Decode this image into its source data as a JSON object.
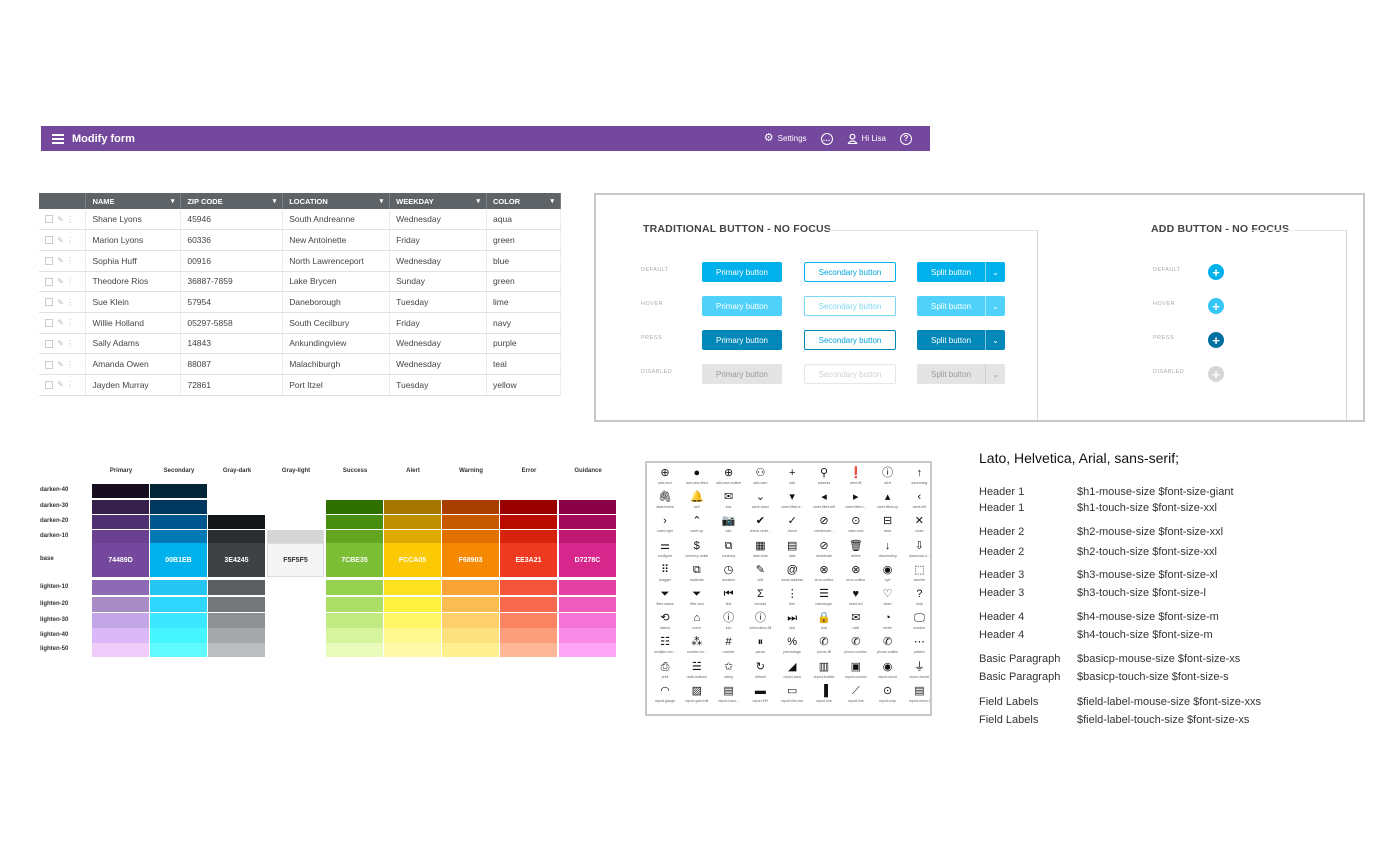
{
  "appbar": {
    "title": "Modify form",
    "settings_label": "Settings",
    "user_label": "Hi Lisa",
    "color": "#74489D"
  },
  "table": {
    "columns": [
      "NAME",
      "ZIP CODE",
      "LOCATION",
      "WEEKDAY",
      "COLOR"
    ],
    "rows": [
      [
        "Shane Lyons",
        "45946",
        "South Andreanne",
        "Wednesday",
        "aqua"
      ],
      [
        "Marion Lyons",
        "60336",
        "New Antoinette",
        "Friday",
        "green"
      ],
      [
        "Sophia Huff",
        "00916",
        "North Lawrenceport",
        "Wednesday",
        "blue"
      ],
      [
        "Theodore Rios",
        "36887-7859",
        "Lake Brycen",
        "Sunday",
        "green"
      ],
      [
        "Sue Klein",
        "57954",
        "Daneborough",
        "Tuesday",
        "lime"
      ],
      [
        "Willie Holland",
        "05297-5858",
        "South Cecilbury",
        "Friday",
        "navy"
      ],
      [
        "Sally Adams",
        "14843",
        "Ankundingview",
        "Wednesday",
        "purple"
      ],
      [
        "Amanda Owen",
        "88087",
        "Malachiburgh",
        "Wednesday",
        "teal"
      ],
      [
        "Jayden Murray",
        "72861",
        "Port Itzel",
        "Tuesday",
        "yellow"
      ]
    ]
  },
  "buttons_panel": {
    "traditional_title": "TRADITIONAL BUTTON - NO FOCUS",
    "add_title": "ADD BUTTON - NO FOCUS",
    "states": [
      "DEFAULT",
      "HOVER",
      "PRESS",
      "DISABLED"
    ],
    "primary_label": "Primary button",
    "secondary_label": "Secondary button",
    "split_label": "Split button"
  },
  "palette": {
    "columns": [
      "Primary",
      "Secondary",
      "Gray-dark",
      "Gray-light",
      "Success",
      "Alert",
      "Warning",
      "Error",
      "Guidance"
    ],
    "rows": [
      "darken-40",
      "darken-30",
      "darken-20",
      "darken-10",
      "base",
      "lighten-10",
      "lighten-20",
      "lighten-30",
      "lighten-40",
      "lighten-50"
    ],
    "base_labels": [
      "74489D",
      "00B1EB",
      "3E4245",
      "F5F5F5",
      "7CBE35",
      "FCCA05",
      "F68903",
      "EE3A21",
      "D7278C"
    ],
    "colors": [
      [
        "#160d1f",
        "#361f4b",
        "#4f3172",
        "#6b4091",
        "#74489D",
        "#8e6ab4",
        "#a98bc6",
        "#c3a6e6",
        "#dbb8f7",
        "#f0ccfb"
      ],
      [
        "#002536",
        "#003760",
        "#00578f",
        "#0079b5",
        "#00B1EB",
        "#25c7f2",
        "#2fd6ff",
        "#3be8ff",
        "#45f5ff",
        "#5ffbff"
      ],
      [
        "",
        "",
        "#131618",
        "#2a2d30",
        "#3E4245",
        "#5b5f62",
        "#74787b",
        "#8d9194",
        "#a4a8ab",
        "#bbbfc1"
      ],
      [
        "",
        "",
        "",
        "#d6d6d6",
        "#F5F5F5",
        "",
        "",
        "",
        "",
        ""
      ],
      [
        "",
        "#2f6f00",
        "#478d0e",
        "#62a521",
        "#7CBE35",
        "#96d24f",
        "#acdf66",
        "#c2ea82",
        "#d6f39d",
        "#e9fbba"
      ],
      [
        "",
        "#a57700",
        "#c08f00",
        "#dcaa00",
        "#FCCA05",
        "#fde21f",
        "#fff23e",
        "#fff668",
        "#fff88e",
        "#fff9a8"
      ],
      [
        "",
        "#a83e00",
        "#c65800",
        "#e07100",
        "#F68903",
        "#f9a336",
        "#fbbd52",
        "#fdd06b",
        "#fee17f",
        "#fff08f"
      ],
      [
        "",
        "#9a0000",
        "#b90b00",
        "#d6230e",
        "#EE3A21",
        "#f4553a",
        "#f86a4e",
        "#fb8463",
        "#fd9e7c",
        "#ffb79a"
      ],
      [
        "",
        "#8a0047",
        "#a40a5c",
        "#bf1873",
        "#D7278C",
        "#e441a4",
        "#ed5bbd",
        "#f473d4",
        "#f98ae6",
        "#fda6f5"
      ]
    ]
  },
  "icons": {
    "items": [
      [
        "⊕",
        "add-mini"
      ],
      [
        "●",
        "add-new-filled"
      ],
      [
        "⊕",
        "add-new-outline"
      ],
      [
        "⚇",
        "add-user"
      ],
      [
        "+",
        "add"
      ],
      [
        "⚲",
        "address"
      ],
      [
        "❗",
        "alert-fill"
      ],
      [
        "ⓘ",
        "alert"
      ],
      [
        "↑",
        "ascending"
      ],
      [
        "🖇",
        "attachment"
      ],
      [
        "🔔",
        "bell"
      ],
      [
        "✉",
        "box"
      ],
      [
        "⌄",
        "caret-down"
      ],
      [
        "▾",
        "caret-filled-d..."
      ],
      [
        "◂",
        "caret-filled-left"
      ],
      [
        "▸",
        "caret-filled-r..."
      ],
      [
        "▴",
        "caret-filled-up"
      ],
      [
        "‹",
        "caret-left"
      ],
      [
        "›",
        "caret-right"
      ],
      [
        "⌃",
        "caret-up"
      ],
      [
        "📷",
        "cart"
      ],
      [
        "✔",
        "check-circle..."
      ],
      [
        "✓",
        "check"
      ],
      [
        "⊘",
        "checkmark..."
      ],
      [
        "⊙",
        "clear-mini"
      ],
      [
        "⊟",
        "clear"
      ],
      [
        "✕",
        "close"
      ],
      [
        "⚌",
        "configure"
      ],
      [
        "$",
        "currency-dollar"
      ],
      [
        "⧉",
        "currency"
      ],
      [
        "▦",
        "date-time"
      ],
      [
        "▤",
        "date"
      ],
      [
        "⊘",
        "deactivate"
      ],
      [
        "🗑",
        "delete"
      ],
      [
        "↓",
        "descending"
      ],
      [
        "⇩",
        "download-o..."
      ],
      [
        "⠿",
        "dragger"
      ],
      [
        "⧉",
        "duplicate"
      ],
      [
        "◷",
        "duration"
      ],
      [
        "✎",
        "edit"
      ],
      [
        "@",
        "email-address"
      ],
      [
        "⊗",
        "error-outline"
      ],
      [
        "⊗",
        "error-outline"
      ],
      [
        "◉",
        "eye"
      ],
      [
        "⬚",
        "favorite"
      ],
      [
        "⏷",
        "filter-status"
      ],
      [
        "⏷",
        "filter-tool"
      ],
      [
        "⏮",
        "first"
      ],
      [
        "Σ",
        "formula"
      ],
      [
        "⋮",
        "free"
      ],
      [
        "☰",
        "hamburger"
      ],
      [
        "♥",
        "heart-full"
      ],
      [
        "♡",
        "heart"
      ],
      [
        "?",
        "help"
      ],
      [
        "⟲",
        "history"
      ],
      [
        "⌂",
        "home"
      ],
      [
        "ⓘ",
        "info"
      ],
      [
        "ⓘ",
        "information-fill"
      ],
      [
        "⏭",
        "last"
      ],
      [
        "🔒",
        "lock"
      ],
      [
        "✉",
        "mail"
      ],
      [
        "◔",
        "meter"
      ],
      [
        "🖵",
        "monitor"
      ],
      [
        "☷",
        "multiple-che..."
      ],
      [
        "⁂",
        "number-for..."
      ],
      [
        "#",
        "number"
      ],
      [
        "⏸",
        "pause"
      ],
      [
        "%",
        "percentage"
      ],
      [
        "✆",
        "phone-fill"
      ],
      [
        "✆",
        "phone-number"
      ],
      [
        "✆",
        "phone-outline"
      ],
      [
        "⋯",
        "pickles"
      ],
      [
        "⎙",
        "print"
      ],
      [
        "☱",
        "radio-buttons"
      ],
      [
        "✩",
        "rating"
      ],
      [
        "↻",
        "refresh"
      ],
      [
        "◢",
        "report-area"
      ],
      [
        "▥",
        "report-bubble"
      ],
      [
        "▣",
        "report-column"
      ],
      [
        "◉",
        "report-donut"
      ],
      [
        "⏚",
        "report-funnel"
      ],
      [
        "◠",
        "report-gauge"
      ],
      [
        "▨",
        "report-grid-edit"
      ],
      [
        "▤",
        "report-horiz..."
      ],
      [
        "▬",
        "report-KPI"
      ],
      [
        "▭",
        "report-line-bar"
      ],
      [
        "▐",
        "report-line"
      ],
      [
        "⟋",
        "report-line"
      ],
      [
        "⊙",
        "report-map"
      ],
      [
        "▤",
        "report-menu-f"
      ]
    ]
  },
  "typography": {
    "font_stack": "Lato, Helvetica, Arial, sans-serif;",
    "rows": [
      [
        "Header 1",
        "$h1-mouse-size  $font-size-giant"
      ],
      [
        "Header 1",
        "$h1-touch-size  $font-size-xxl"
      ],
      [
        "Header 2",
        "$h2-mouse-size  $font-size-xxl"
      ],
      [
        "Header 2",
        "$h2-touch-size  $font-size-xxl"
      ],
      [
        "Header 3",
        "$h3-mouse-size  $font-size-xl"
      ],
      [
        "Header 3",
        "$h3-touch-size  $font-size-l"
      ],
      [
        "Header 4",
        "$h4-mouse-size  $font-size-m"
      ],
      [
        "Header 4",
        "$h4-touch-size  $font-size-m"
      ],
      [
        "Basic Paragraph",
        "$basicp-mouse-size  $font-size-xs"
      ],
      [
        "Basic Paragraph",
        "$basicp-touch-size  $font-size-s"
      ],
      [
        "Field Labels",
        "$field-label-mouse-size  $font-size-xxs"
      ],
      [
        "Field Labels",
        "$field-label-touch-size  $font-size-xs"
      ]
    ]
  }
}
